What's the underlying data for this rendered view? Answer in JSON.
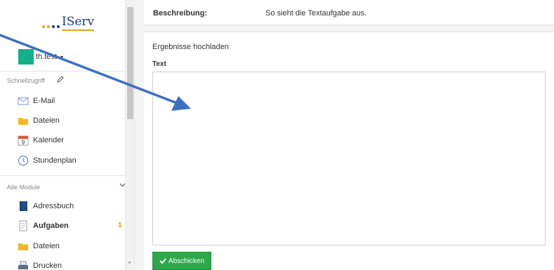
{
  "sidebar": {
    "logo_text": "IServ",
    "user": {
      "name": "th.test",
      "caret": "▾"
    },
    "quick_access_label": "Schnellzugriff",
    "quick_items": [
      {
        "label": "E-Mail",
        "icon": "mail-icon"
      },
      {
        "label": "Dateien",
        "icon": "folder-icon"
      },
      {
        "label": "Kalender",
        "icon": "calendar-icon",
        "calendar_day": "9"
      },
      {
        "label": "Stundenplan",
        "icon": "clock-icon"
      }
    ],
    "modules_label": "Alle Module",
    "modules": [
      {
        "label": "Adressbuch",
        "icon": "addressbook-icon"
      },
      {
        "label": "Aufgaben",
        "icon": "tasks-icon",
        "badge": "1",
        "active": true
      },
      {
        "label": "Dateien",
        "icon": "folder-icon"
      },
      {
        "label": "Drucken",
        "icon": "printer-icon"
      }
    ]
  },
  "main": {
    "description_label": "Beschreibung:",
    "description_value": "So sieht die Textaufgabe aus.",
    "upload_title": "Ergebnisse hochladen",
    "text_label": "Text",
    "text_value": "",
    "submit_label": "Abschicken"
  },
  "colors": {
    "brand_blue": "#1a3a8c",
    "brand_orange": "#e8a317",
    "avatar": "#15b08a",
    "submit_green": "#2ea84a",
    "badge_orange": "#f08c00",
    "annotation_arrow": "#3d6fc4"
  }
}
